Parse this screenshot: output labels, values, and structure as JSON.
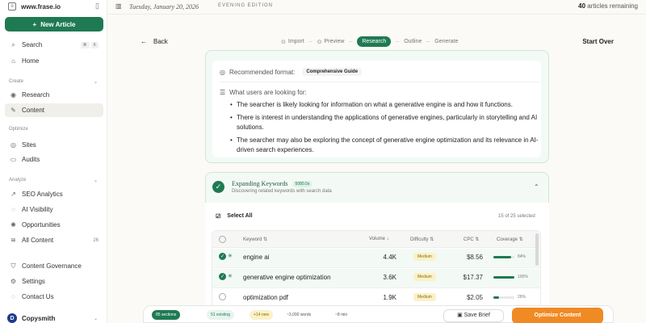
{
  "sidebar": {
    "brand": "www.frase.io",
    "new_article": "New Article",
    "search": "Search",
    "search_kbd": [
      "⌘",
      "K"
    ],
    "home": "Home",
    "sections": {
      "create": "Create",
      "optimize": "Optimize",
      "analyze": "Analyze"
    },
    "create_items": [
      "Research",
      "Content"
    ],
    "optimize_items": [
      "Sites",
      "Audits"
    ],
    "analyze_items": [
      "SEO Analytics",
      "AI Visibility",
      "Opportunities"
    ],
    "all_content": "All Content",
    "all_content_count": "26",
    "bottom_items": [
      "Content Governance",
      "Settings",
      "Contact Us"
    ],
    "user": {
      "initial": "D",
      "name": "Copysmith"
    }
  },
  "topbar": {
    "date": "Tuesday, January 20, 2026",
    "edition": "EVENING EDITION",
    "remaining_count": "40",
    "remaining_text": "articles remaining"
  },
  "stepper": {
    "back": "Back",
    "steps": [
      "Import",
      "Preview",
      "Research",
      "Outline",
      "Generate"
    ],
    "active_step": "Research",
    "start_over": "Start Over"
  },
  "intent": {
    "format_label": "Recommended format:",
    "format_value": "Comprehensive Guide",
    "looking_label": "What users are looking for:",
    "bullets": [
      "The searcher is likely looking for information on what a generative engine is and how it functions.",
      "There is interest in understanding the applications of generative engines, particularly in storytelling and AI solutions.",
      "The searcher may also be exploring the concept of generative engine optimization and its relevance in AI-driven search experiences."
    ]
  },
  "expanding": {
    "title": "Expanding Keywords",
    "badge": "5080.0s",
    "subtitle": "Discovering related keywords with search data"
  },
  "keywords": {
    "select_all": "Select All",
    "selected": "15 of 25 selected",
    "headers": {
      "keyword": "Keyword ⇅",
      "volume": "Volume ↓",
      "difficulty": "Difficulty ⇅",
      "cpc": "CPC ⇅",
      "coverage": "Coverage ⇅"
    },
    "rows": [
      {
        "keyword": "engine ai",
        "volume": "4.4K",
        "difficulty": "Medium",
        "cpc": "$8.56",
        "coverage": "84%",
        "coverage_value": 84,
        "selected": true
      },
      {
        "keyword": "generative engine optimization",
        "volume": "3.6K",
        "difficulty": "Medium",
        "cpc": "$17.37",
        "coverage": "100%",
        "coverage_value": 100,
        "selected": true
      },
      {
        "keyword": "optimization pdf",
        "volume": "1.9K",
        "difficulty": "Medium",
        "cpc": "$2.05",
        "coverage": "26%",
        "coverage_value": 26,
        "selected": false
      }
    ]
  },
  "bottombar": {
    "chips": [
      "85 sections",
      "51 existing",
      "+14 new",
      "~3,000 words",
      "~8 min"
    ],
    "save_brief": "Save Brief",
    "optimize": "Optimize Content"
  },
  "colors": {
    "accent": "#1f7a52",
    "orange": "#f08a24"
  }
}
